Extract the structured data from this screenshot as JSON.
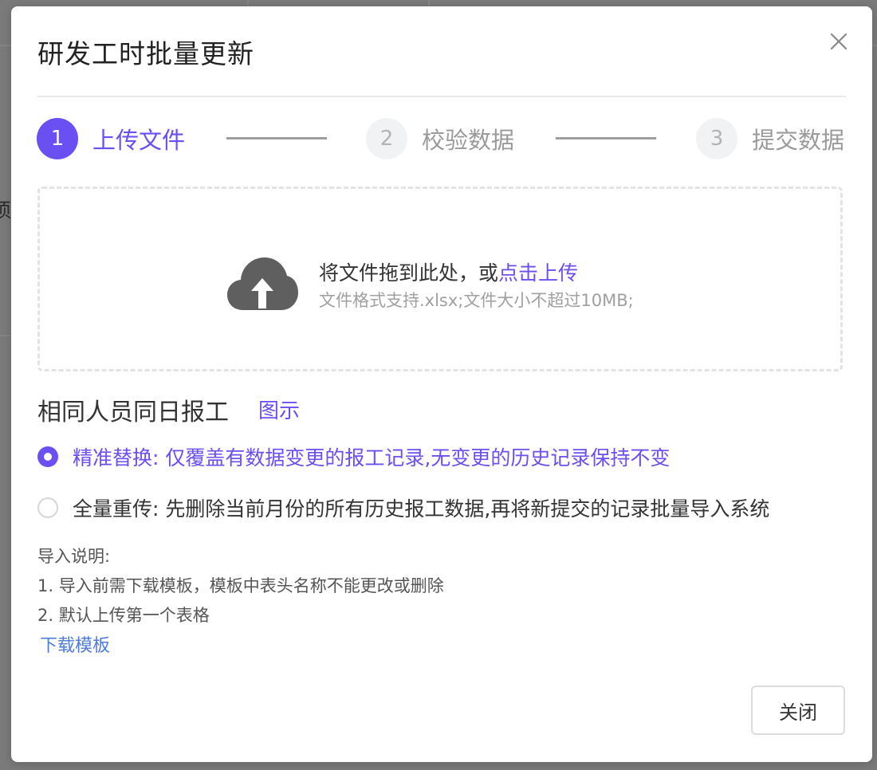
{
  "background": {
    "partial_char": "须"
  },
  "modal": {
    "title": "研发工时批量更新",
    "close_icon": "close-icon"
  },
  "steps": [
    {
      "number": "1",
      "label": "上传文件",
      "state": "active"
    },
    {
      "number": "2",
      "label": "校验数据",
      "state": "idle"
    },
    {
      "number": "3",
      "label": "提交数据",
      "state": "idle"
    }
  ],
  "upload": {
    "icon": "cloud-upload-icon",
    "prompt": "将文件拖到此处，或",
    "link": "点击上传",
    "hint": "文件格式支持.xlsx;文件大小不超过10MB;"
  },
  "same_day": {
    "title": "相同人员同日报工",
    "illustration_link": "图示"
  },
  "options": [
    {
      "label": "精准替换: 仅覆盖有数据变更的报工记录,无变更的历史记录保持不变",
      "checked": true
    },
    {
      "label": "全量重传: 先删除当前月份的所有历史报工数据,再将新提交的记录批量导入系统",
      "checked": false
    }
  ],
  "notes": {
    "heading": "导入说明:",
    "items": [
      "1. 导入前需下载模板，模板中表头名称不能更改或删除",
      "2. 默认上传第一个表格"
    ],
    "download_link": "下载模板"
  },
  "footer": {
    "close_button": "关闭"
  },
  "colors": {
    "accent": "#6a4ff3",
    "link_blue": "#4f7cd9",
    "overlay": "#7a7a7a"
  }
}
